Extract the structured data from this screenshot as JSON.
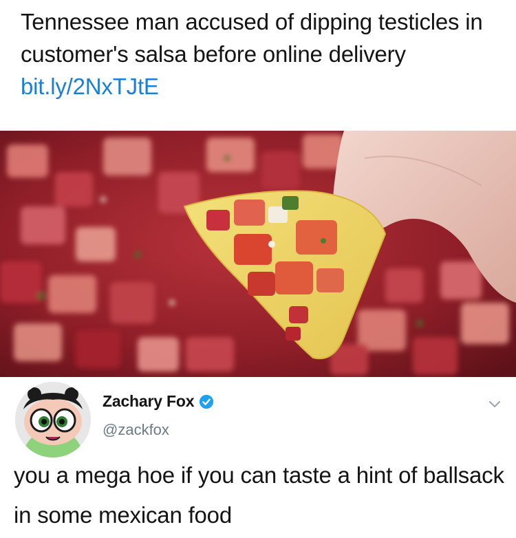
{
  "headline": {
    "text": "Tennessee man accused of dipping testicles in customer's salsa before online delivery",
    "link": "bit.ly/2NxTJtE"
  },
  "photo": {
    "subject": "tortilla-chip-with-salsa-icon"
  },
  "tweet": {
    "display_name": "Zachary Fox",
    "handle": "@zackfox",
    "text": "you a mega hoe if you can taste a hint of ballsack in some mexican food",
    "verified": true
  },
  "colors": {
    "link": "#1b7fd6",
    "verified_badge": "#1da1f2",
    "handle": "#6a7a87"
  }
}
